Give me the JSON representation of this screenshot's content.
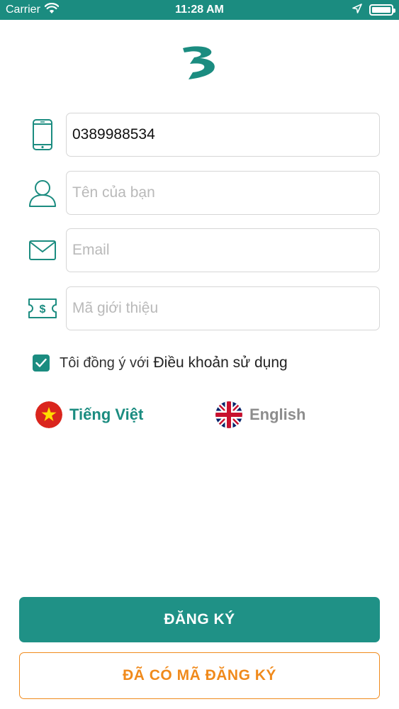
{
  "status_bar": {
    "carrier": "Carrier",
    "time": "11:28 AM",
    "battery_level": 1.0
  },
  "theme": {
    "primary": "#1b8c80",
    "accent": "#f08a1c"
  },
  "form": {
    "phone": {
      "value": "0389988534",
      "placeholder": "",
      "icon": "phone-icon"
    },
    "name": {
      "value": "",
      "placeholder": "Tên của bạn",
      "icon": "user-icon"
    },
    "email": {
      "value": "",
      "placeholder": "Email",
      "icon": "mail-icon"
    },
    "referral": {
      "value": "",
      "placeholder": "Mã giới thiệu",
      "icon": "ticket-icon"
    }
  },
  "terms": {
    "checked": true,
    "prefix": "Tôi đồng ý với",
    "link": "Điều khoản sử dụng"
  },
  "languages": {
    "vietnamese": {
      "label": "Tiếng Việt",
      "selected": true
    },
    "english": {
      "label": "English",
      "selected": false
    }
  },
  "buttons": {
    "register": "ĐĂNG KÝ",
    "have_code": "ĐÃ CÓ MÃ ĐĂNG KÝ"
  }
}
